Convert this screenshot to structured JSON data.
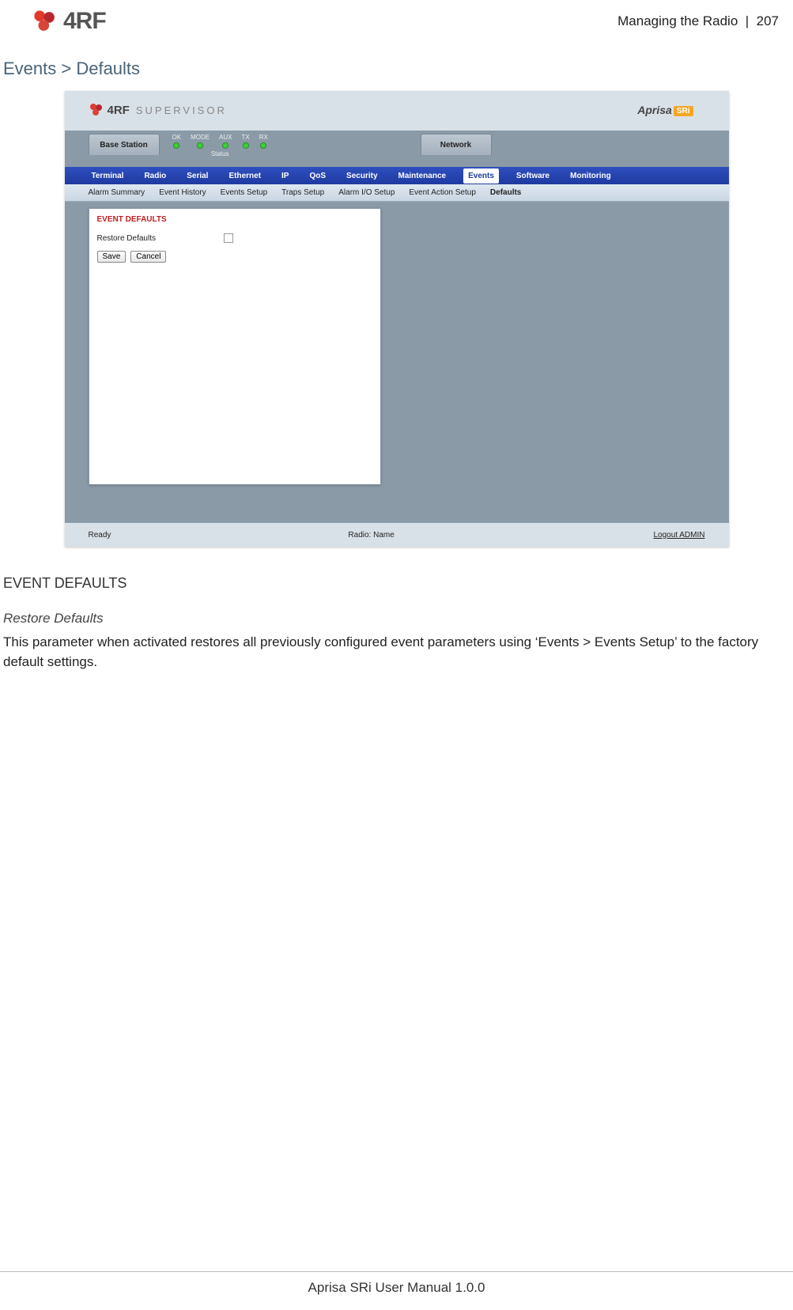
{
  "header": {
    "logo_text": "4RF",
    "section": "Managing the Radio",
    "divider": "|",
    "page": "207"
  },
  "breadcrumb": "Events > Defaults",
  "screenshot": {
    "supervisor_brand": "4RF",
    "supervisor_label": "SUPERVISOR",
    "right_brand": "Aprisa",
    "right_brand_box": "SRi",
    "device_tab": "Base Station",
    "network_tab": "Network",
    "status": {
      "leds": [
        "OK",
        "MODE",
        "AUX",
        "TX",
        "RX"
      ],
      "caption": "Status"
    },
    "main_tabs": [
      "Terminal",
      "Radio",
      "Serial",
      "Ethernet",
      "IP",
      "QoS",
      "Security",
      "Maintenance",
      "Events",
      "Software",
      "Monitoring"
    ],
    "main_active_idx": 8,
    "sub_tabs": [
      "Alarm Summary",
      "Event History",
      "Events Setup",
      "Traps Setup",
      "Alarm I/O Setup",
      "Event Action Setup",
      "Defaults"
    ],
    "sub_active_idx": 6,
    "panel": {
      "title": "EVENT DEFAULTS",
      "checkbox_label": "Restore Defaults",
      "save": "Save",
      "cancel": "Cancel"
    },
    "footer": {
      "left": "Ready",
      "mid": "Radio: Name",
      "right": "Logout ADMIN"
    }
  },
  "body": {
    "section_title": "EVENT DEFAULTS",
    "sub_title": "Restore Defaults",
    "paragraph": "This parameter when activated restores all previously configured event parameters using ‘Events > Events Setup’ to the factory default settings."
  },
  "footer": "Aprisa SRi User Manual 1.0.0"
}
